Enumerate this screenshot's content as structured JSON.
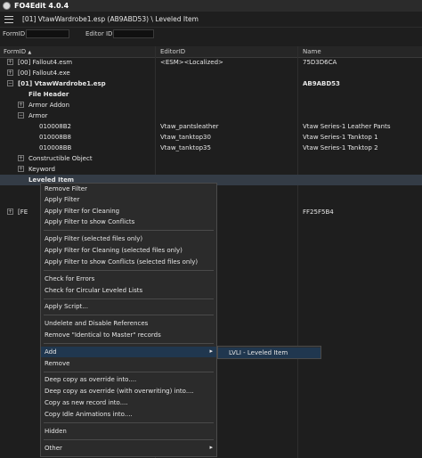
{
  "app": {
    "title": "FO4Edit 4.0.4"
  },
  "toolbar": {
    "path": "[01] VtawWardrobe1.esp (AB9ABD53) \\ Leveled Item"
  },
  "filters": {
    "formid_label": "FormID",
    "editorid_label": "Editor ID",
    "formid_value": "",
    "editorid_value": ""
  },
  "columns": {
    "formid": "FormID",
    "sort_indicator": "▲",
    "editorid": "EditorID",
    "name": "Name"
  },
  "tree": [
    {
      "expander": "+",
      "formid": "[00] Fallout4.esm",
      "editorid": "<ESM><Localized>",
      "name": "75D3D6CA",
      "bold": false
    },
    {
      "expander": "+",
      "formid": "[00] Fallout4.exe",
      "editorid": "",
      "name": "",
      "bold": false
    },
    {
      "expander": "−",
      "formid": "[01] VtawWardrobe1.esp",
      "editorid": "",
      "name": "AB9ABD53",
      "bold": true
    },
    {
      "expander": "",
      "formid": "File Header",
      "editorid": "",
      "name": "",
      "bold": true
    },
    {
      "expander": "+",
      "formid": "Armor Addon",
      "editorid": "",
      "name": "",
      "bold": false
    },
    {
      "expander": "−",
      "formid": "Armor",
      "editorid": "",
      "name": "",
      "bold": false
    },
    {
      "expander": "",
      "formid": "010008B2",
      "editorid": "Vtaw_pantsleather",
      "name": "Vtaw Series-1 Leather Pants",
      "bold": false
    },
    {
      "expander": "",
      "formid": "010008B8",
      "editorid": "Vtaw_tanktop30",
      "name": "Vtaw Series-1 Tanktop 1",
      "bold": false
    },
    {
      "expander": "",
      "formid": "010008BB",
      "editorid": "Vtaw_tanktop35",
      "name": "Vtaw Series-1 Tanktop 2",
      "bold": false
    },
    {
      "expander": "+",
      "formid": "Constructible Object",
      "editorid": "",
      "name": "",
      "bold": false
    },
    {
      "expander": "+",
      "formid": "Keyword",
      "editorid": "",
      "name": "",
      "bold": false
    },
    {
      "expander": "",
      "formid": "Leveled Item",
      "editorid": "",
      "name": "",
      "bold": true
    },
    {
      "expander": "+",
      "formid": "[FE",
      "editorid": "",
      "name": "FF25F5B4",
      "bold": false
    }
  ],
  "context_menu": {
    "items": [
      "Remove Filter",
      "Apply Filter",
      "Apply Filter for Cleaning",
      "Apply Filter to show Conflicts",
      "Apply Filter (selected files only)",
      "Apply Filter for Cleaning (selected files only)",
      "Apply Filter to show Conflicts (selected files only)",
      "Check for Errors",
      "Check for Circular Leveled Lists",
      "Apply Script...",
      "Undelete and Disable References",
      "Remove \"Identical to Master\" records",
      "Add",
      "Remove",
      "Deep copy as override into....",
      "Deep copy as override (with overwriting) into....",
      "Copy as new record into....",
      "Copy Idle Animations into....",
      "Hidden",
      "Other"
    ],
    "submenu_arrow": "▸"
  },
  "submenu": {
    "item": "LVLI - Leveled Item"
  }
}
